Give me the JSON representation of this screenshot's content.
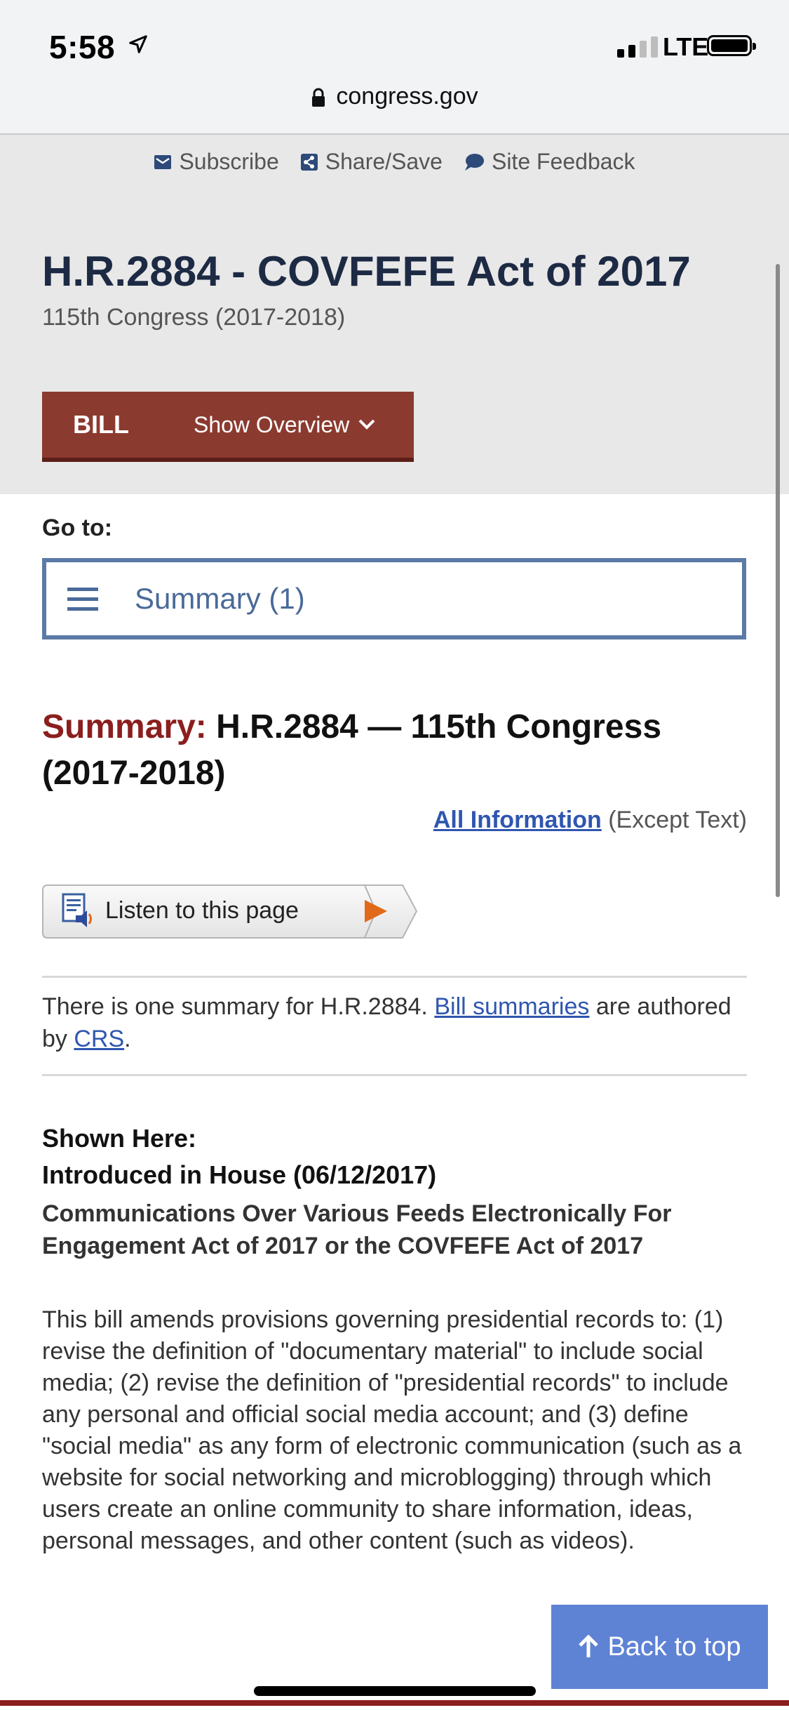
{
  "status_bar": {
    "time": "5:58",
    "network": "LTE",
    "icons": [
      "location-arrow-icon",
      "signal-icon",
      "battery-icon"
    ]
  },
  "browser": {
    "url": "congress.gov"
  },
  "utility_nav": {
    "subscribe": "Subscribe",
    "share": "Share/Save",
    "feedback": "Site Feedback"
  },
  "bill": {
    "title": "H.R.2884 - COVFEFE Act of 2017",
    "congress": "115th Congress (2017-2018)",
    "type_label": "BILL",
    "overview_label": "Show Overview"
  },
  "goto": {
    "label": "Go to:",
    "selected": "Summary (1)"
  },
  "summary": {
    "heading_prefix": "Summary:",
    "heading_rest": "H.R.2884 — 115th Congress (2017-2018)",
    "all_info_link": "All Information",
    "all_info_suffix": "(Except Text)",
    "listen_label": "Listen to this page",
    "intro_before": "There is one summary for H.R.2884.",
    "intro_link_1": "Bill summaries",
    "intro_middle": "are authored by",
    "intro_link_2": "CRS",
    "intro_end": ".",
    "shown_here": "Shown Here:",
    "introduced": "Introduced in House (06/12/2017)",
    "full_title": "Communications Over Various Feeds Electronically For Engagement Act of 2017 or the COVFEFE Act of 2017",
    "body": "This bill amends provisions governing presidential records to: (1) revise the definition of \"documentary material\" to include social media; (2) revise the definition of \"presidential records\" to include any personal and official social media account; and (3) define \"social media\" as any form of electronic communication (such as a website for social networking and microblogging) through which users create an online community to share information, ideas, personal messages, and other content (such as videos)."
  },
  "back_to_top": "Back to top",
  "colors": {
    "brand_red": "#8b3a2f",
    "heading_navy": "#1d2a44",
    "link_blue": "#2f56b0",
    "select_border": "#5b7aa6",
    "back_to_top_bg": "#5e82d4"
  }
}
